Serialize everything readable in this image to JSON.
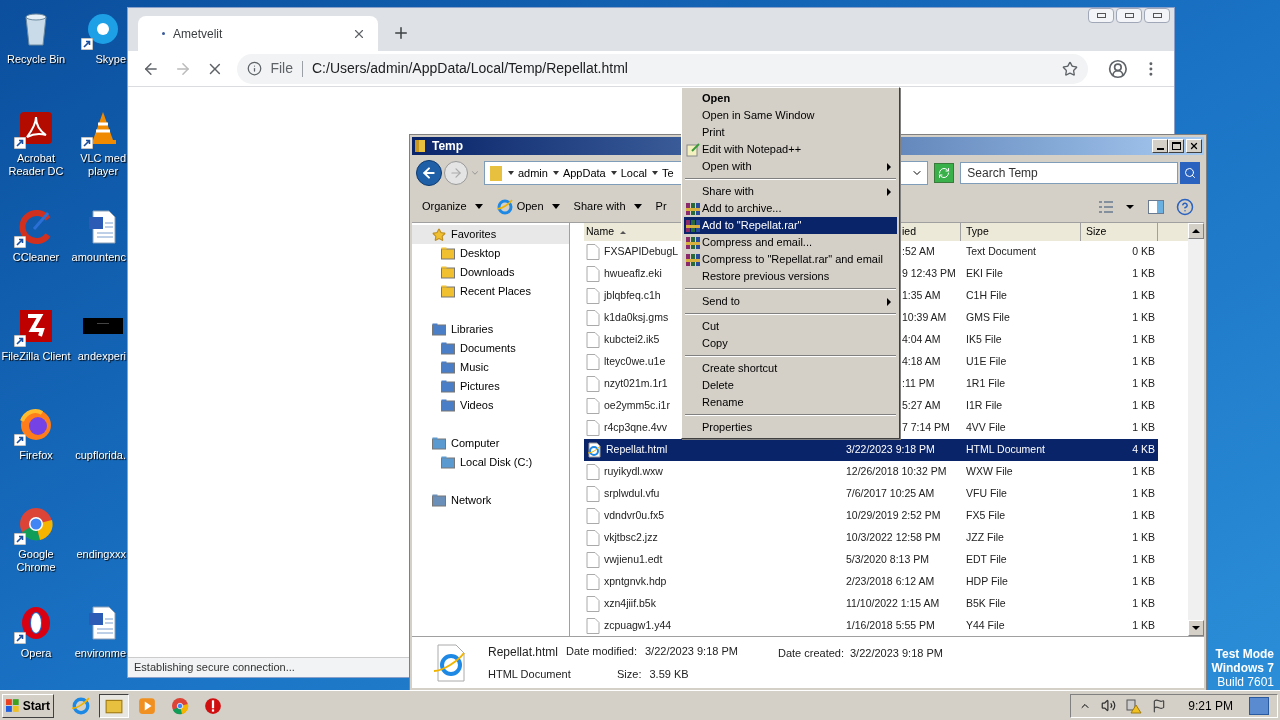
{
  "desktop": {
    "icons": [
      {
        "lines": [
          "Recycle Bin"
        ],
        "shortcut": false
      },
      {
        "lines": [
          "Skype"
        ],
        "shortcut": true
      },
      {
        "lines": [
          "Acrobat",
          "Reader DC"
        ],
        "shortcut": true
      },
      {
        "lines": [
          "VLC med",
          "player"
        ],
        "shortcut": true
      },
      {
        "lines": [
          "CCleaner"
        ],
        "shortcut": true
      },
      {
        "lines": [
          "amountenc"
        ],
        "shortcut": false
      },
      {
        "lines": [
          "FileZilla Client"
        ],
        "shortcut": true
      },
      {
        "lines": [
          "andexperi"
        ],
        "shortcut": false
      },
      {
        "lines": [
          "Firefox"
        ],
        "shortcut": true
      },
      {
        "lines": [
          "cupflorida."
        ],
        "shortcut": false
      },
      {
        "lines": [
          "Google",
          "Chrome"
        ],
        "shortcut": true
      },
      {
        "lines": [
          "endingxxx"
        ],
        "shortcut": false
      },
      {
        "lines": [
          "Opera"
        ],
        "shortcut": true
      },
      {
        "lines": [
          "environme"
        ],
        "shortcut": false
      }
    ],
    "test_mode": [
      "Test Mode",
      "Windows 7",
      "Build 7601"
    ]
  },
  "browser": {
    "tab": {
      "title": "Ametvelit"
    },
    "back_disabled": false,
    "forward_disabled": true,
    "scheme": "File",
    "url": "C:/Users/admin/AppData/Local/Temp/Repellat.html",
    "status": "Establishing secure connection..."
  },
  "explorer": {
    "title": "Temp",
    "breadcrumb": [
      "admin",
      "AppData",
      "Local",
      "Te"
    ],
    "search": {
      "placeholder": "Search Temp"
    },
    "toolbar": [
      {
        "label": "Organize",
        "dropdown": true
      },
      {
        "label": "Open",
        "dropdown": true
      },
      {
        "label": "Share with",
        "dropdown": true
      },
      {
        "label": "Pr"
      }
    ],
    "nav": [
      {
        "label": "Favorites",
        "children": [
          {
            "label": "Desktop"
          },
          {
            "label": "Downloads"
          },
          {
            "label": "Recent Places"
          }
        ]
      },
      {
        "label": "Libraries",
        "children": [
          {
            "label": "Documents"
          },
          {
            "label": "Music"
          },
          {
            "label": "Pictures"
          },
          {
            "label": "Videos"
          }
        ]
      },
      {
        "label": "Computer",
        "children": [
          {
            "label": "Local Disk (C:)"
          }
        ]
      },
      {
        "label": "Network"
      }
    ],
    "columns": [
      {
        "label": "Name",
        "sorted": true
      },
      {
        "label": "ied",
        "sorted": false
      },
      {
        "label": "Type",
        "sorted": false
      },
      {
        "label": "Size",
        "sorted": false
      }
    ],
    "files": [
      {
        "kind": "blank",
        "name": "FXSAPIDebugL",
        "modified": ":52 AM",
        "type": "Text Document",
        "size": "0 KB",
        "selected": false,
        "covered": true
      },
      {
        "kind": "blank",
        "name": "hwueaflz.eki",
        "modified": "9 12:43 PM",
        "type": "EKI File",
        "size": "1 KB",
        "selected": false,
        "covered": true
      },
      {
        "kind": "blank",
        "name": "jblqbfeq.c1h",
        "modified": "1:35 AM",
        "type": "C1H File",
        "size": "1 KB",
        "selected": false,
        "covered": true
      },
      {
        "kind": "blank",
        "name": "k1da0ksj.gms",
        "modified": "10:39 AM",
        "type": "GMS File",
        "size": "1 KB",
        "selected": false,
        "covered": true
      },
      {
        "kind": "blank",
        "name": "kubctei2.ik5",
        "modified": "4:04 AM",
        "type": "IK5 File",
        "size": "1 KB",
        "selected": false,
        "covered": true
      },
      {
        "kind": "blank",
        "name": "lteyc0we.u1e",
        "modified": "4:18 AM",
        "type": "U1E File",
        "size": "1 KB",
        "selected": false,
        "covered": true
      },
      {
        "kind": "blank",
        "name": "nzyt021m.1r1",
        "modified": ":11 PM",
        "type": "1R1 File",
        "size": "1 KB",
        "selected": false,
        "covered": true
      },
      {
        "kind": "blank",
        "name": "oe2ymm5c.i1r",
        "modified": "5:27 AM",
        "type": "I1R File",
        "size": "1 KB",
        "selected": false,
        "covered": true
      },
      {
        "kind": "blank",
        "name": "r4cp3qne.4vv",
        "modified": "7 7:14 PM",
        "type": "4VV File",
        "size": "1 KB",
        "selected": false,
        "covered": true
      },
      {
        "kind": "html",
        "name": "Repellat.html",
        "modified": "3/22/2023 9:18 PM",
        "type": "HTML Document",
        "size": "4 KB",
        "selected": true,
        "covered": false
      },
      {
        "kind": "blank",
        "name": "ruyikydl.wxw",
        "modified": "12/26/2018 10:32 PM",
        "type": "WXW File",
        "size": "1 KB",
        "selected": false,
        "covered": false
      },
      {
        "kind": "blank",
        "name": "srplwdul.vfu",
        "modified": "7/6/2017 10:25 AM",
        "type": "VFU File",
        "size": "1 KB",
        "selected": false,
        "covered": false
      },
      {
        "kind": "blank",
        "name": "vdndvr0u.fx5",
        "modified": "10/29/2019 2:52 PM",
        "type": "FX5 File",
        "size": "1 KB",
        "selected": false,
        "covered": false
      },
      {
        "kind": "blank",
        "name": "vkjtbsc2.jzz",
        "modified": "10/3/2022 12:58 PM",
        "type": "JZZ File",
        "size": "1 KB",
        "selected": false,
        "covered": false
      },
      {
        "kind": "blank",
        "name": "vwjienu1.edt",
        "modified": "5/3/2020 8:13 PM",
        "type": "EDT File",
        "size": "1 KB",
        "selected": false,
        "covered": false
      },
      {
        "kind": "blank",
        "name": "xpntgnvk.hdp",
        "modified": "2/23/2018 6:12 AM",
        "type": "HDP File",
        "size": "1 KB",
        "selected": false,
        "covered": false
      },
      {
        "kind": "blank",
        "name": "xzn4jiif.b5k",
        "modified": "11/10/2022 1:15 AM",
        "type": "B5K File",
        "size": "1 KB",
        "selected": false,
        "covered": false
      },
      {
        "kind": "blank",
        "name": "zcpuagw1.y44",
        "modified": "1/16/2018 5:55 PM",
        "type": "Y44 File",
        "size": "1 KB",
        "selected": false,
        "covered": false
      }
    ],
    "details": {
      "name": "Repellat.html",
      "type": "HTML Document",
      "modified_label": "Date modified:",
      "modified": "3/22/2023 9:18 PM",
      "size_label": "Size:",
      "size": "3.59 KB",
      "created_label": "Date created:",
      "created": "3/22/2023 9:18 PM"
    }
  },
  "context_menu": {
    "items": [
      {
        "kind": "item",
        "label": "Open",
        "default": true,
        "selected": false,
        "submenu": false,
        "icon": false
      },
      {
        "kind": "item",
        "label": "Open in Same Window",
        "default": false,
        "selected": false,
        "submenu": false,
        "icon": false
      },
      {
        "kind": "item",
        "label": "Print",
        "default": false,
        "selected": false,
        "submenu": false,
        "icon": false
      },
      {
        "kind": "item",
        "label": "Edit with Notepad++",
        "default": false,
        "selected": false,
        "submenu": false,
        "icon": true
      },
      {
        "kind": "item",
        "label": "Open with",
        "default": false,
        "selected": false,
        "submenu": true,
        "icon": false
      },
      {
        "kind": "separator"
      },
      {
        "kind": "item",
        "label": "Share with",
        "default": false,
        "selected": false,
        "submenu": true,
        "icon": false
      },
      {
        "kind": "item",
        "label": "Add to archive...",
        "default": false,
        "selected": false,
        "submenu": false,
        "icon": true
      },
      {
        "kind": "item",
        "label": "Add to \"Repellat.rar\"",
        "default": false,
        "selected": true,
        "submenu": false,
        "icon": true
      },
      {
        "kind": "item",
        "label": "Compress and email...",
        "default": false,
        "selected": false,
        "submenu": false,
        "icon": true
      },
      {
        "kind": "item",
        "label": "Compress to \"Repellat.rar\" and email",
        "default": false,
        "selected": false,
        "submenu": false,
        "icon": true
      },
      {
        "kind": "item",
        "label": "Restore previous versions",
        "default": false,
        "selected": false,
        "submenu": false,
        "icon": false
      },
      {
        "kind": "separator"
      },
      {
        "kind": "item",
        "label": "Send to",
        "default": false,
        "selected": false,
        "submenu": true,
        "icon": false
      },
      {
        "kind": "separator"
      },
      {
        "kind": "item",
        "label": "Cut",
        "default": false,
        "selected": false,
        "submenu": false,
        "icon": false
      },
      {
        "kind": "item",
        "label": "Copy",
        "default": false,
        "selected": false,
        "submenu": false,
        "icon": false
      },
      {
        "kind": "separator"
      },
      {
        "kind": "item",
        "label": "Create shortcut",
        "default": false,
        "selected": false,
        "submenu": false,
        "icon": false
      },
      {
        "kind": "item",
        "label": "Delete",
        "default": false,
        "selected": false,
        "submenu": false,
        "icon": false
      },
      {
        "kind": "item",
        "label": "Rename",
        "default": false,
        "selected": false,
        "submenu": false,
        "icon": false
      },
      {
        "kind": "separator"
      },
      {
        "kind": "item",
        "label": "Properties",
        "default": false,
        "selected": false,
        "submenu": false,
        "icon": false
      }
    ]
  },
  "taskbar": {
    "start": "Start",
    "clock": "9:21 PM",
    "apps": [
      {
        "active": false
      },
      {
        "active": true
      },
      {
        "active": false
      },
      {
        "active": false
      },
      {
        "active": false
      }
    ]
  }
}
